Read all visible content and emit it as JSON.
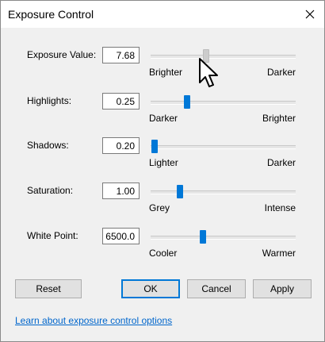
{
  "window": {
    "title": "Exposure Control"
  },
  "controls": [
    {
      "label": "Exposure Value:",
      "value": "7.68",
      "min_label": "Brighter",
      "max_label": "Darker",
      "level": 0.38,
      "state": "disabled"
    },
    {
      "label": "Highlights:",
      "value": "0.25",
      "min_label": "Darker",
      "max_label": "Brighter",
      "level": 0.25,
      "state": "normal"
    },
    {
      "label": "Shadows:",
      "value": "0.20",
      "min_label": "Lighter",
      "max_label": "Darker",
      "level": 0.03,
      "state": "normal"
    },
    {
      "label": "Saturation:",
      "value": "1.00",
      "min_label": "Grey",
      "max_label": "Intense",
      "level": 0.2,
      "state": "normal"
    },
    {
      "label": "White Point:",
      "value": "6500.0",
      "min_label": "Cooler",
      "max_label": "Warmer",
      "level": 0.36,
      "state": "normal"
    }
  ],
  "buttons": {
    "reset": "Reset",
    "ok": "OK",
    "cancel": "Cancel",
    "apply": "Apply"
  },
  "link": {
    "text": "Learn about exposure control options"
  },
  "colors": {
    "accent": "#0078d7",
    "disabled_thumb": "#cccccc",
    "link": "#0066cc"
  },
  "icons": {
    "close": "close-icon",
    "cursor": "mouse-pointer-icon"
  }
}
